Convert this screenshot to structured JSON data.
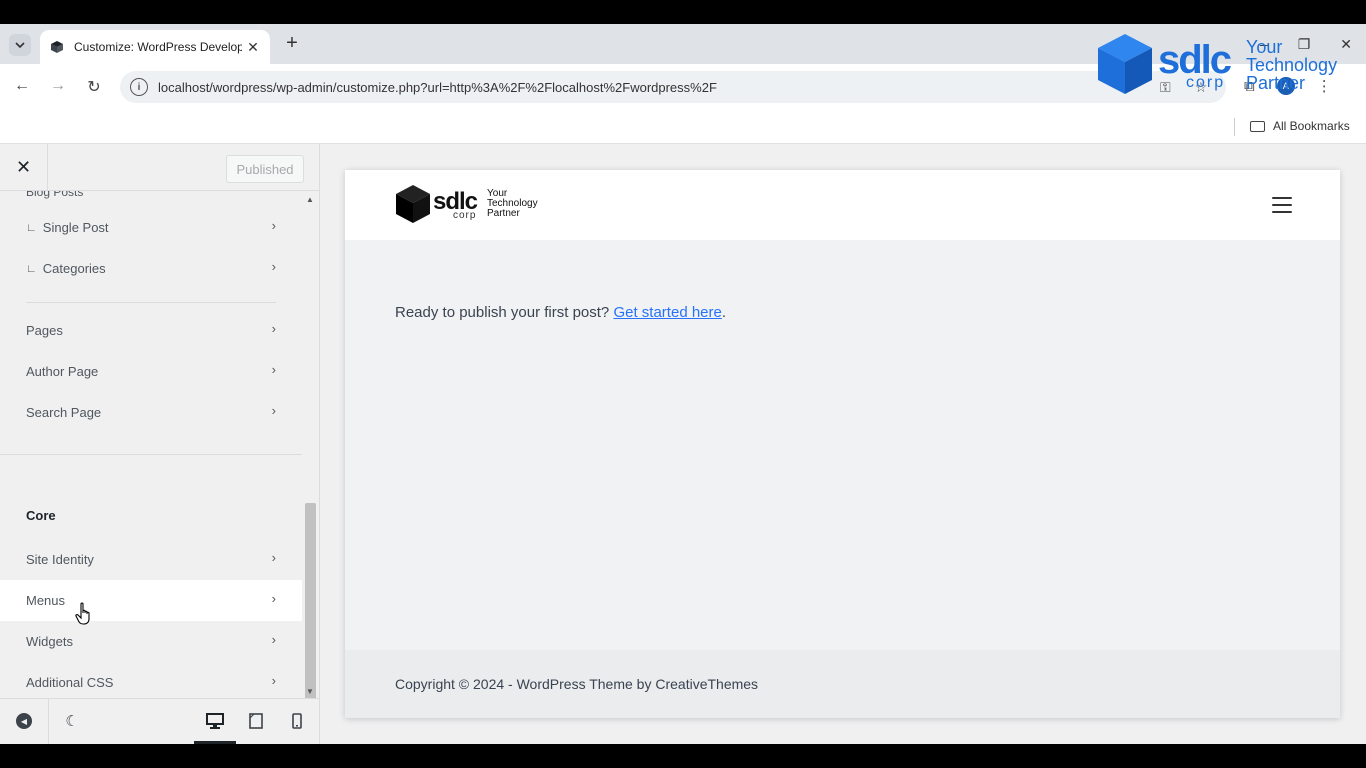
{
  "browser": {
    "tab_title": "Customize: WordPress Develop",
    "tab_close": "✕",
    "new_tab": "+",
    "url": "localhost/wordpress/wp-admin/customize.php?url=http%3A%2F%2Flocalhost%2Fwordpress%2F",
    "bookmarks_all": "All Bookmarks",
    "avatar_letter": "A",
    "window_controls": [
      "–",
      "❐",
      "✕"
    ]
  },
  "watermark": {
    "brand": "sdlc",
    "corp": "corp",
    "tagline": [
      "Your",
      "Technology",
      "Partner"
    ],
    "color": "#1e6fd9"
  },
  "customizer": {
    "close_label": "✕",
    "published_label": "Published",
    "partial_heading": "Blog Posts",
    "items_top": [
      {
        "label": "Single Post",
        "sub": true
      },
      {
        "label": "Categories",
        "sub": true
      }
    ],
    "items_mid": [
      {
        "label": "Pages"
      },
      {
        "label": "Author Page"
      },
      {
        "label": "Search Page"
      }
    ],
    "core_heading": "Core",
    "items_core": [
      {
        "label": "Site Identity"
      },
      {
        "label": "Menus"
      },
      {
        "label": "Widgets"
      },
      {
        "label": "Additional CSS"
      }
    ],
    "chevron": "›",
    "sub_marker": "∟"
  },
  "preview": {
    "logo": {
      "brand": "sdlc",
      "corp": "corp",
      "tagline": [
        "Your",
        "Technology",
        "Partner"
      ]
    },
    "body_text": "Ready to publish your first post?",
    "body_link": "Get started here",
    "body_suffix": ".",
    "footer_text": "Copyright © 2024 - WordPress Theme by CreativeThemes",
    "link_color": "#2872fa"
  }
}
